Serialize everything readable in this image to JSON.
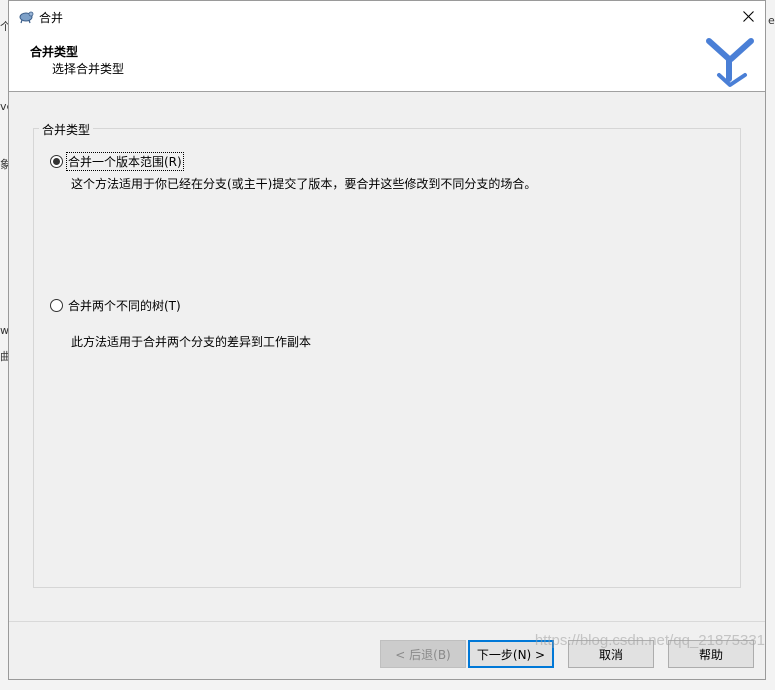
{
  "window": {
    "title": "合并",
    "close_icon": "close-icon"
  },
  "header": {
    "title": "合并类型",
    "subtitle": "选择合并类型"
  },
  "group": {
    "legend": "合并类型",
    "options": [
      {
        "label": "合并一个版本范围(R)",
        "description": "这个方法适用于你已经在分支(或主干)提交了版本，要合并这些修改到不同分支的场合。",
        "checked": true
      },
      {
        "label": "合并两个不同的树(T)",
        "description": "此方法适用于合并两个分支的差异到工作副本",
        "checked": false
      }
    ]
  },
  "buttons": {
    "back": "< 后退(B)",
    "next": "下一步(N) >",
    "cancel": "取消",
    "help": "帮助"
  },
  "background": {
    "fragments": [
      "个",
      "ve",
      "象",
      "w",
      "曲",
      "e"
    ]
  },
  "watermark": "https://blog.csdn.net/qq_21875331",
  "colors": {
    "dialog_bg": "#f0f0f0",
    "default_button_border": "#0078d7",
    "logo_blue": "#4a7fd6"
  }
}
